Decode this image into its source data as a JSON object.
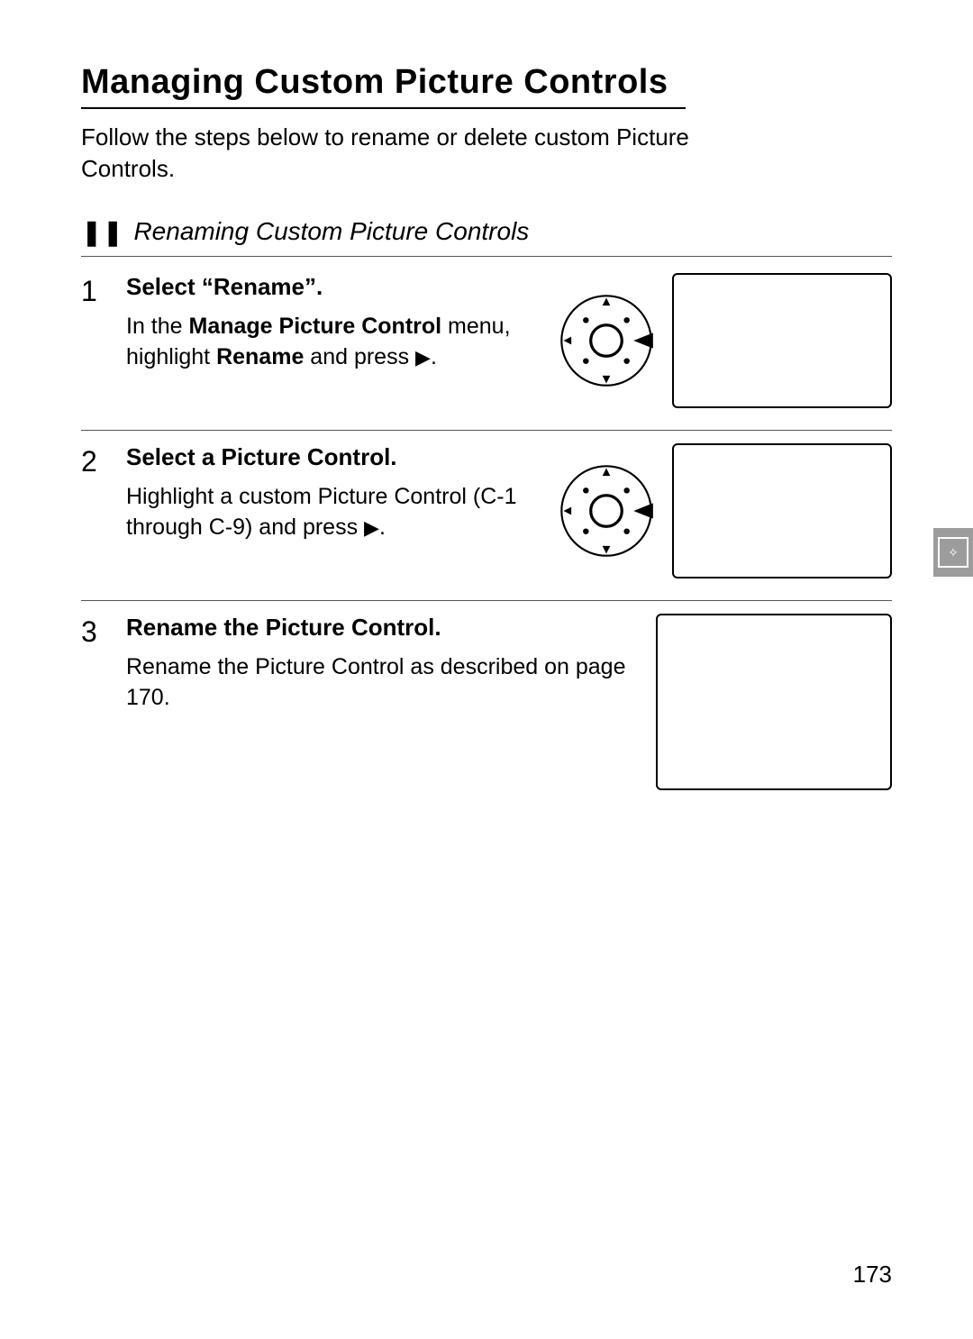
{
  "title": "Managing Custom Picture Controls",
  "intro": "Follow the steps below to rename or delete custom Picture Controls.",
  "subsection": {
    "label": "❚❚",
    "title": "Renaming Custom Picture Controls"
  },
  "steps": [
    {
      "num": "1",
      "head": "Select “Rename”.",
      "body_prefix": "In the ",
      "body_bold1": "Manage Picture Control",
      "body_mid": " menu, highlight ",
      "body_bold2": "Rename",
      "body_after": " and press ",
      "body_tri": "▶",
      "body_end": "."
    },
    {
      "num": "2",
      "head": "Select a Picture Control.",
      "body": "Highlight a custom Picture Control (C-1 through C-9) and press ",
      "body_tri": "▶",
      "body_end": "."
    },
    {
      "num": "3",
      "head": "Rename the Picture Control.",
      "body": "Rename the Picture Control as described on page 170."
    }
  ],
  "page_number": "173",
  "side_tab_icon": "picture-control-icon"
}
